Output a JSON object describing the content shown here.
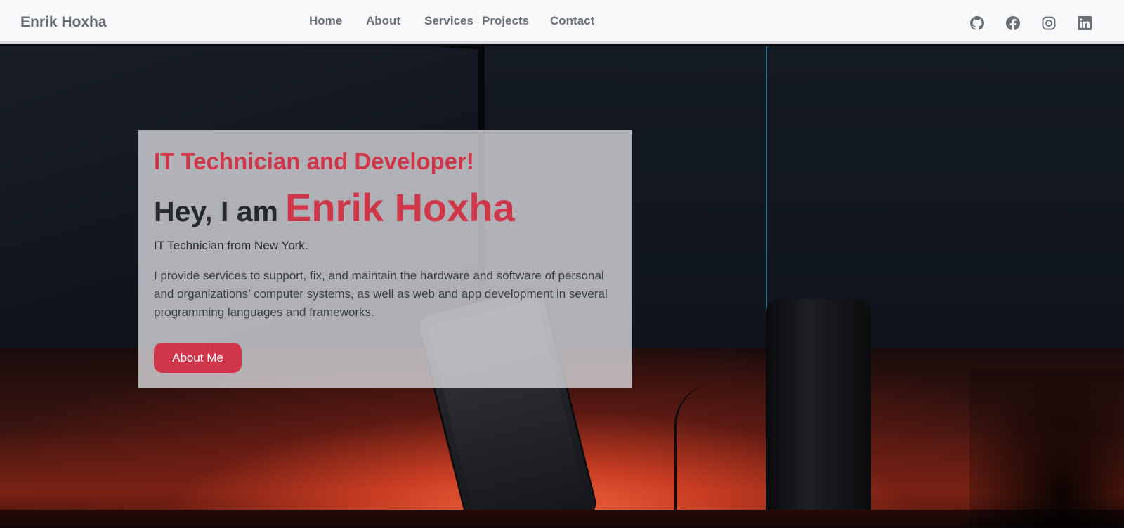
{
  "navbar": {
    "brand": "Enrik Hoxha",
    "links": [
      "Home",
      "About",
      "Services",
      "Projects",
      "Contact"
    ],
    "social_icons": [
      "github-icon",
      "facebook-icon",
      "instagram-icon",
      "linkedin-icon"
    ],
    "icon_color": "#6c7075"
  },
  "hero": {
    "tagline": "IT Technician and Developer!",
    "greeting_prefix": "Hey, I am",
    "name": "Enrik Hoxha",
    "location": "IT Technician from New York.",
    "description": "I provide services to support, fix, and maintain the hardware and software of personal and organizations’ computer systems, as well as web and app development in several programming languages and frameworks.",
    "button_label": "About Me"
  },
  "colors": {
    "accent": "#d0364a",
    "navbar_bg": "#f8f9fa",
    "card_bg": "rgba(222,222,225,0.78)"
  }
}
